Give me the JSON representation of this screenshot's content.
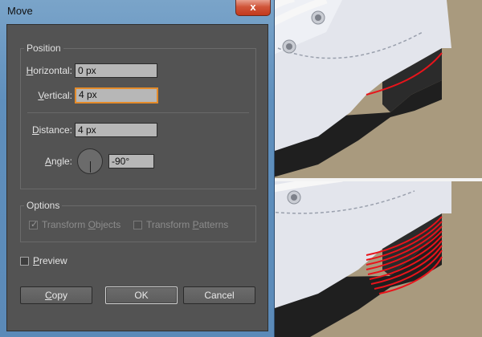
{
  "window": {
    "title": "Move",
    "close_glyph": "x"
  },
  "position": {
    "legend": "Position",
    "horizontal_label_u": "H",
    "horizontal_label_rest": "orizontal:",
    "horizontal_value": "0 px",
    "vertical_label_u": "V",
    "vertical_label_rest": "ertical:",
    "vertical_value": "4 px",
    "distance_label_u": "D",
    "distance_label_rest": "istance:",
    "distance_value": "4 px",
    "angle_label_u": "A",
    "angle_label_rest": "ngle:",
    "angle_value": "-90°"
  },
  "options": {
    "legend": "Options",
    "transform_objects_pre": "Transform ",
    "transform_objects_u": "O",
    "transform_objects_post": "bjects",
    "transform_objects_checked": true,
    "transform_patterns_pre": "Transform ",
    "transform_patterns_u": "P",
    "transform_patterns_post": "atterns",
    "transform_patterns_checked": false
  },
  "preview": {
    "label_u": "P",
    "label_rest": "review",
    "checked": false
  },
  "buttons": {
    "copy_u": "C",
    "copy_rest": "opy",
    "ok": "OK",
    "cancel": "Cancel"
  },
  "colors": {
    "accent_focus": "#e48b2a",
    "stroke_red": "#e8141b",
    "boot_white": "#e6e8ee",
    "sole_black": "#1e1e1e",
    "floor": "#a99a7e"
  },
  "icons": {
    "close": "close-icon",
    "checkmark": "checkmark-icon",
    "angle_dial": "angle-dial-icon"
  }
}
